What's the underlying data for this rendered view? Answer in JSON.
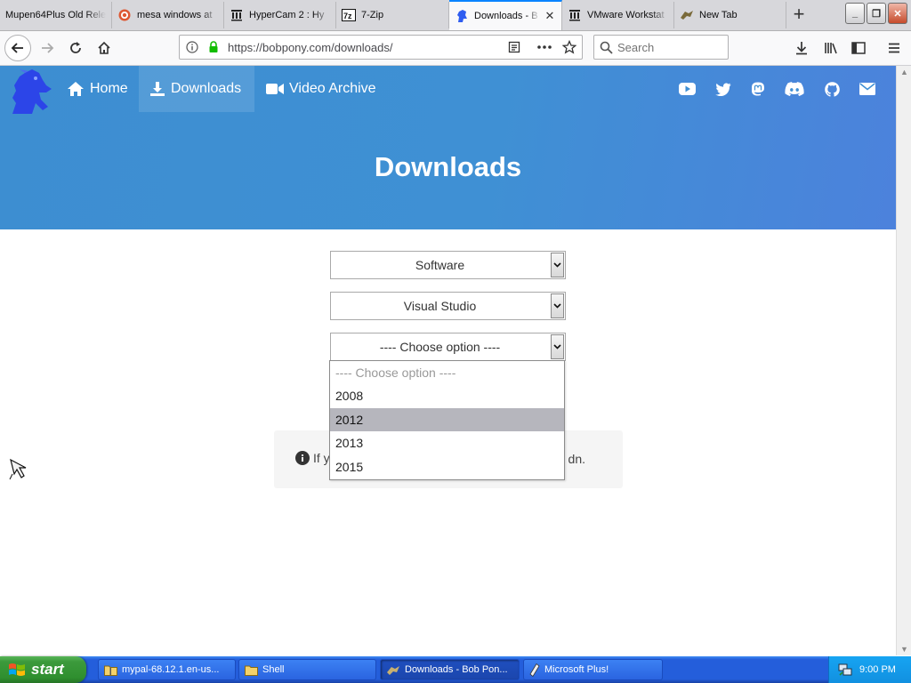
{
  "browser": {
    "tabs": [
      {
        "label": "Mupen64Plus Old Rele",
        "icon": "none",
        "active": false
      },
      {
        "label": "mesa windows at",
        "icon": "duckduckgo-icon",
        "active": false
      },
      {
        "label": "HyperCam 2 : Hy",
        "icon": "archive-org-icon",
        "active": false
      },
      {
        "label": "7-Zip",
        "icon": "7zip-icon",
        "active": false
      },
      {
        "label": "Downloads - B",
        "icon": "bobpony-icon",
        "active": true
      },
      {
        "label": "VMware Workstat",
        "icon": "archive-org-icon",
        "active": false
      },
      {
        "label": "New Tab",
        "icon": "bobpony-icon",
        "active": false
      }
    ],
    "new_tab_symbol": "+",
    "url": "https://bobpony.com/downloads/",
    "search_placeholder": "Search",
    "window_controls": {
      "minimize": "_",
      "restore": "❐",
      "close": "✕"
    },
    "tab_close_symbol": "✕"
  },
  "site": {
    "nav": [
      {
        "label": "Home",
        "icon": "home-icon",
        "active": false
      },
      {
        "label": "Downloads",
        "icon": "download-icon",
        "active": true
      },
      {
        "label": "Video Archive",
        "icon": "video-camera-icon",
        "active": false
      }
    ],
    "social_icons": [
      "youtube-icon",
      "twitter-icon",
      "mastodon-icon",
      "discord-icon",
      "github-icon",
      "email-icon"
    ],
    "title": "Downloads",
    "selects": {
      "category": "Software",
      "product": "Visual Studio",
      "version": "---- Choose option ----"
    },
    "dropdown_options": [
      {
        "label": "---- Choose option ----",
        "placeholder": true,
        "selected": false
      },
      {
        "label": "2008",
        "placeholder": false,
        "selected": false
      },
      {
        "label": "2012",
        "placeholder": false,
        "selected": true
      },
      {
        "label": "2013",
        "placeholder": false,
        "selected": false
      },
      {
        "label": "2015",
        "placeholder": false,
        "selected": false
      }
    ],
    "info_text_left": "If y",
    "info_text_right": "dn."
  },
  "taskbar": {
    "start_label": "start",
    "tasks": [
      {
        "label": "mypal-68.12.1.en-us...",
        "icon": "zip-folder-icon",
        "active": false
      },
      {
        "label": "Shell",
        "icon": "folder-icon",
        "active": false
      },
      {
        "label": "Downloads - Bob Pon...",
        "icon": "bobpony-icon",
        "active": true
      },
      {
        "label": "Microsoft Plus!",
        "icon": "microsoft-plus-icon",
        "active": false
      }
    ],
    "clock": "9:00 PM"
  },
  "colors": {
    "hero_gradient_start": "#3d8ed1",
    "hero_gradient_end": "#4c82dc",
    "tab_active_accent": "#0a84ff",
    "taskbar_blue": "#245edb",
    "start_green": "#3c9a3c",
    "dropdown_selected": "#b6b6bd"
  }
}
